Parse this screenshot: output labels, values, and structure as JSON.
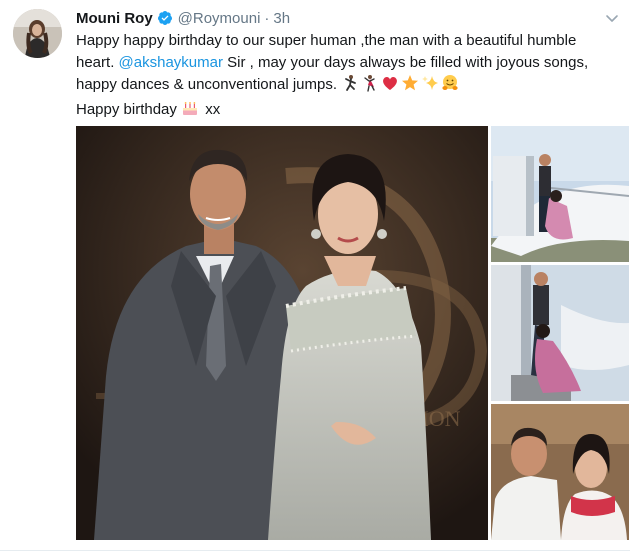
{
  "tweet": {
    "author_name": "Mouni Roy",
    "handle": "@Roymouni",
    "separator": "·",
    "time": "3h",
    "verified": true,
    "text_line1": "Happy happy birthday to our super human ,the man with a beautiful humble",
    "text_line2_prefix": "heart. ",
    "mention": "@akshaykumar",
    "text_line2_suffix": " Sir , may your days always be filled with joyous songs,",
    "text_line3": "happy dances & unconventional jumps. ",
    "text_line4": "Happy birthday ",
    "text_line4_suffix": " xx"
  },
  "emojis": [
    "man-dancing-icon",
    "woman-dancing-icon",
    "red-heart-icon",
    "star-icon",
    "sparkles-icon",
    "hugging-face-icon",
    "birthday-cake-icon"
  ],
  "colors": {
    "link": "#1b95e0",
    "secondary_text": "#657786",
    "verified_badge": "#1da1f2"
  }
}
